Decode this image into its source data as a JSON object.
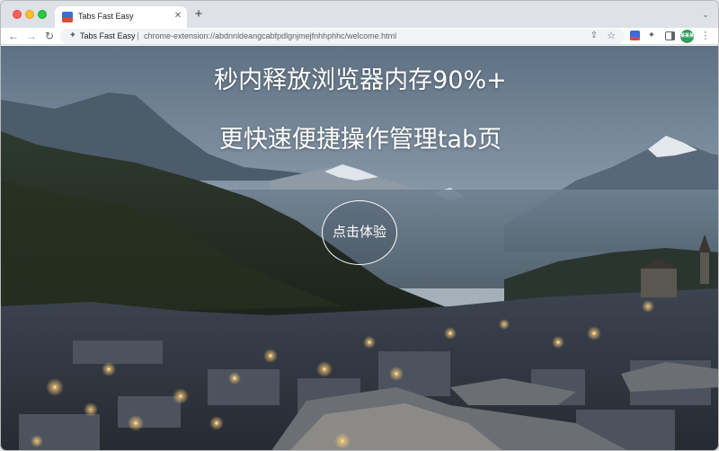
{
  "browser": {
    "tab": {
      "title": "Tabs Fast Easy",
      "favicon": "tabs-fast-easy-logo-icon",
      "close_glyph": "✕"
    },
    "new_tab_glyph": "+",
    "tab_menu_glyph": "⌄",
    "nav": {
      "back_glyph": "←",
      "forward_glyph": "→",
      "reload_glyph": "↻"
    },
    "omnibox": {
      "extension_icon": "puzzle-icon",
      "extension_glyph": "✦",
      "extension_name": "Tabs Fast Easy",
      "url": "chrome-extension://abdnnldeangcabfpdlgnjmejfnhhphhc/welcome.html",
      "share_glyph": "⇪",
      "bookmark_glyph": "☆"
    },
    "toolbar": {
      "puzzle_glyph": "✦",
      "avatar_text": "某某某",
      "avatar_color": "#2f9e5b",
      "menu_glyph": "⋮"
    }
  },
  "hero": {
    "line1": "秒内释放浏览器内存90%+",
    "line2": "更快速便捷操作管理tab页",
    "cta_label": "点击体验",
    "text_color": "#ffffff"
  }
}
